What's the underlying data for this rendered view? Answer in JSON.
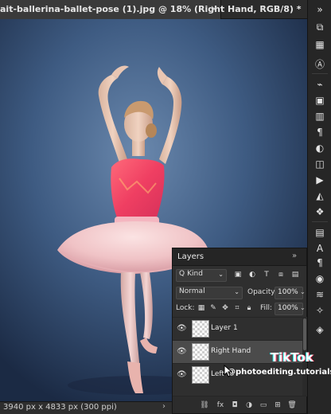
{
  "document": {
    "tab_title": "ait-ballerina-ballet-pose (1).jpg @ 18% (Right Hand, RGB/8) *",
    "close_glyph": "×"
  },
  "status_bar": {
    "info": "3940 px x 4833 px (300 ppi)",
    "arrow": "›"
  },
  "layers_panel": {
    "title": "Layers",
    "collapse_glyph": "»",
    "filter": {
      "kind_glyph": "Q",
      "kind_label": "Kind",
      "caret": "⌄",
      "icons": [
        "image-filter-icon",
        "adjustment-filter-icon",
        "type-filter-icon",
        "shape-filter-icon",
        "smart-object-filter-icon",
        "filter-toggle-icon"
      ]
    },
    "blend_mode": "Normal",
    "opacity_label": "Opacity:",
    "opacity_value": "100%",
    "lock_label": "Lock:",
    "fill_label": "Fill:",
    "fill_value": "100%",
    "layers": [
      {
        "name": "Layer 1",
        "selected": false,
        "visible": true
      },
      {
        "name": "Right Hand",
        "selected": true,
        "visible": true
      },
      {
        "name": "Left",
        "selected": false,
        "visible": true
      }
    ],
    "footer_icons": [
      "link-layers-icon",
      "fx-icon",
      "add-mask-icon",
      "adjustment-layer-icon",
      "new-group-icon",
      "new-layer-icon",
      "delete-layer-icon"
    ]
  },
  "right_toolbar": {
    "icons": [
      "history-icon",
      "properties-icon",
      "paragraph-icon",
      "type-icon",
      "glyphs-icon",
      "brush-icon",
      "shapes-icon",
      "histogram-icon",
      "paragraph-style-icon",
      "color-icon",
      "swatches-icon",
      "gradient-icon",
      "pattern-icon",
      "play-icon",
      "adjustments-icon",
      "libraries-icon",
      "character-icon",
      "fill-icon",
      "navigator-icon",
      "type-a-icon",
      "channels-icon",
      "paths-icon",
      "properties-sliders-icon",
      "styles-icon",
      "layers-icon"
    ]
  },
  "watermark": {
    "brand": "TikTok",
    "handle": "@photoediting.tutorials"
  }
}
